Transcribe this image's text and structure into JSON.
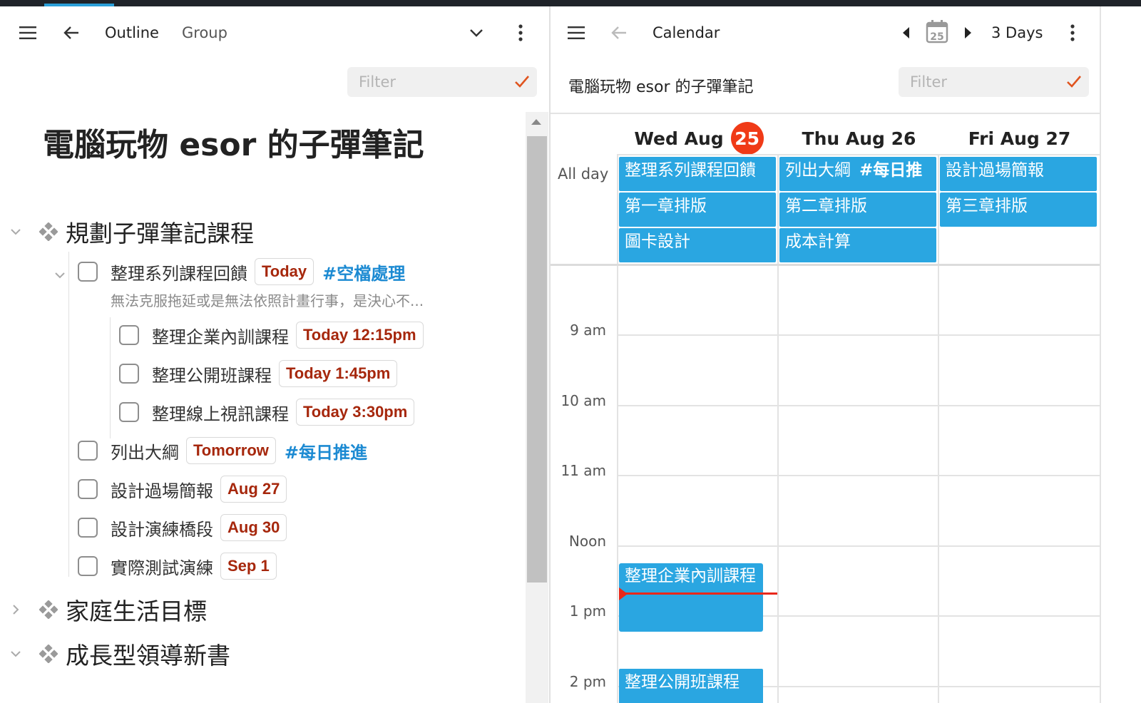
{
  "left": {
    "header": {
      "outline_label": "Outline",
      "group_label": "Group"
    },
    "filter_placeholder": "Filter",
    "doc_title": "電腦玩物 esor 的子彈筆記",
    "sections": [
      {
        "title": "規劃子彈筆記課程"
      },
      {
        "title": "家庭生活目標"
      },
      {
        "title": "成長型領導新書"
      }
    ],
    "tasks": [
      {
        "label": "整理系列課程回饋",
        "date": "Today",
        "tag": "#空檔處理",
        "note": "無法克服拖延或是無法依照計畫行事，是決心不..."
      },
      {
        "label": "整理企業內訓課程",
        "date": "Today 12:15pm"
      },
      {
        "label": "整理公開班課程",
        "date": "Today 1:45pm"
      },
      {
        "label": "整理線上視訊課程",
        "date": "Today 3:30pm"
      },
      {
        "label": "列出大綱",
        "date": "Tomorrow",
        "tag": "#每日推進"
      },
      {
        "label": "設計過場簡報",
        "date": "Aug 27"
      },
      {
        "label": "設計演練橋段",
        "date": "Aug 30"
      },
      {
        "label": "實際測試演練",
        "date": "Sep 1"
      }
    ]
  },
  "right": {
    "header": {
      "title": "Calendar",
      "date_icon_num": "25",
      "view_label": "3 Days"
    },
    "subtitle": "電腦玩物 esor 的子彈筆記",
    "filter_placeholder": "Filter",
    "days": [
      {
        "label": "Wed Aug",
        "badge": "25"
      },
      {
        "label": "Thu Aug 26"
      },
      {
        "label": "Fri Aug 27"
      }
    ],
    "allday_label": "All day",
    "allday_events": {
      "wed": [
        "整理系列課程回饋",
        "第一章排版",
        "圖卡設計"
      ],
      "thu": {
        "first": "列出大綱",
        "first_tag": "#每日推",
        "rest": [
          "第二章排版",
          "成本計算"
        ]
      },
      "fri": [
        "設計過場簡報",
        "第三章排版"
      ]
    },
    "time_labels": [
      "9 am",
      "10 am",
      "11 am",
      "Noon",
      "1 pm",
      "2 pm"
    ],
    "timed_events": [
      "整理企業內訓課程",
      "整理公開班課程"
    ]
  }
}
